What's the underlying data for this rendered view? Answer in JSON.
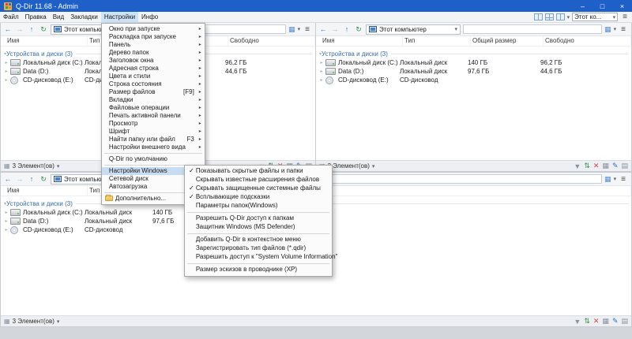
{
  "window": {
    "title": "Q-Dir 11.68 - Admin"
  },
  "titlebar": {
    "minimize": "–",
    "maximize": "□",
    "close": "×"
  },
  "menubar": {
    "items": [
      "Файл",
      "Правка",
      "Вид",
      "Закладки",
      "Настройки",
      "Инфо"
    ],
    "combo_value": "Этот ко..."
  },
  "icons": {
    "check": "✓",
    "arrow": "▸",
    "caret": "▾",
    "back": "←",
    "forward": "→",
    "up": "↑",
    "refresh": "↻",
    "hamburger": "≡",
    "grid": "▦",
    "notes": "▤",
    "swap": "⇅",
    "delete": "✕",
    "pencil": "✎",
    "funnel": "▼"
  },
  "pane": {
    "address": "Этот компьютер",
    "columns": [
      "Имя",
      "Тип",
      "Общий размер",
      "Свободно"
    ],
    "group_label": "Устройства и диски (3)",
    "rows": [
      {
        "name": "Локальный диск (C:)",
        "type": "Локальный диск",
        "size": "140 ГБ",
        "free": "96,2 ГБ"
      },
      {
        "name": "Data (D:)",
        "type": "Локальный диск",
        "size": "97,6 ГБ",
        "free": "44,6 ГБ"
      },
      {
        "name": "CD-дисковод (E:)",
        "type": "CD-дисковод",
        "size": "",
        "free": ""
      }
    ],
    "status": "3 Элемент(ов)"
  },
  "settings_menu": {
    "items": [
      {
        "label": "Окно при запуске"
      },
      {
        "label": "Раскладка при запуске"
      },
      {
        "label": "Панель"
      },
      {
        "label": "Дерево папок"
      },
      {
        "label": "Заголовок окна"
      },
      {
        "label": "Адресная строка"
      },
      {
        "label": "Цвета и стили"
      },
      {
        "label": "Строка состояния"
      },
      {
        "label": "Размер файлов",
        "shortcut": "[F9]"
      },
      {
        "label": "Вкладки"
      },
      {
        "label": "Файловые операции"
      },
      {
        "label": "Печать активной панели"
      },
      {
        "label": "Просмотр"
      },
      {
        "label": "Шрифт"
      },
      {
        "label": "Найти папку или файл",
        "shortcut": "F3"
      },
      {
        "label": "Настройки внешнего вида"
      },
      {
        "label": "Q-Dir по умолчанию"
      },
      {
        "label": "Настройки Windows"
      },
      {
        "label": "Сетевой диск"
      },
      {
        "label": "Автозагрузка"
      },
      {
        "label": "Дополнительно..."
      }
    ]
  },
  "windows_submenu": {
    "items": [
      {
        "label": "Показывать скрытые файлы и папки",
        "checked": true
      },
      {
        "label": "Скрывать известные расширения файлов",
        "checked": false
      },
      {
        "label": "Скрывать защищенные системные файлы",
        "checked": true
      },
      {
        "label": "Всплывающие подсказки",
        "checked": true
      },
      {
        "label": "Параметры папок(Windows)",
        "checked": false
      },
      {
        "label": "Разрешить Q-Dir доступ к папкам",
        "checked": false
      },
      {
        "label": "Защитник Windows (MS Defender)",
        "checked": false
      },
      {
        "label": "Добавить Q-Dir в контекстное меню",
        "checked": false
      },
      {
        "label": "Зарегистрировать тип файлов (*.qdir)",
        "checked": false
      },
      {
        "label": "Разрешить доступ к \"System Volume Information\"",
        "checked": false
      },
      {
        "label": "Размер эскизов в проводнике (XP)",
        "checked": false
      }
    ]
  }
}
